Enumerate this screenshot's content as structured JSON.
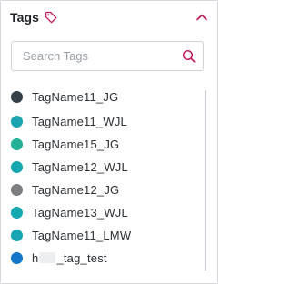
{
  "header": {
    "title": "Tags"
  },
  "colors": {
    "accent": "#c2185b"
  },
  "search": {
    "placeholder": "Search Tags",
    "value": ""
  },
  "tags": [
    {
      "label": "TagName11_JG",
      "color": "#343e48"
    },
    {
      "label": "TagName11_WJL",
      "color": "#18a4b1"
    },
    {
      "label": "TagName15_JG",
      "color": "#23b096"
    },
    {
      "label": "TagName12_WJL",
      "color": "#14a7b0"
    },
    {
      "label": "TagName12_JG",
      "color": "#7d7e80"
    },
    {
      "label": "TagName13_WJL",
      "color": "#13a7b1"
    },
    {
      "label": "TagName11_LMW",
      "color": "#17a6b4"
    },
    {
      "label_prefix": "h",
      "label_suffix": "_tag_test",
      "color": "#1376c8"
    }
  ]
}
